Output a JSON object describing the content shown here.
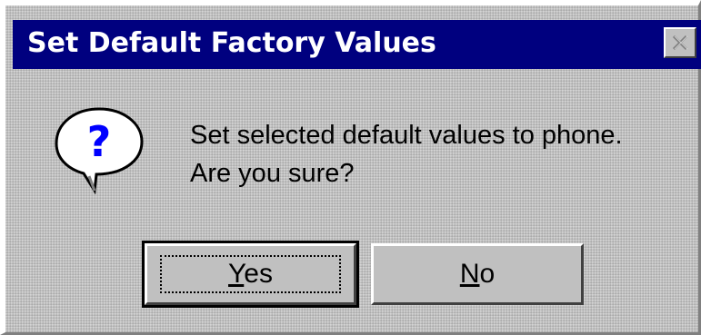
{
  "window": {
    "title": "Set Default Factory Values",
    "close_icon": "close-icon"
  },
  "dialog": {
    "icon": "question-icon",
    "message_line1": "Set selected default values to phone.",
    "message_line2": "Are you sure?"
  },
  "buttons": {
    "yes": {
      "mnemonic": "Y",
      "rest": "es"
    },
    "no": {
      "mnemonic": "N",
      "rest": "o"
    }
  },
  "colors": {
    "titlebar": "#00007f",
    "face": "#c0c0c0",
    "title_text": "#ffffff"
  }
}
